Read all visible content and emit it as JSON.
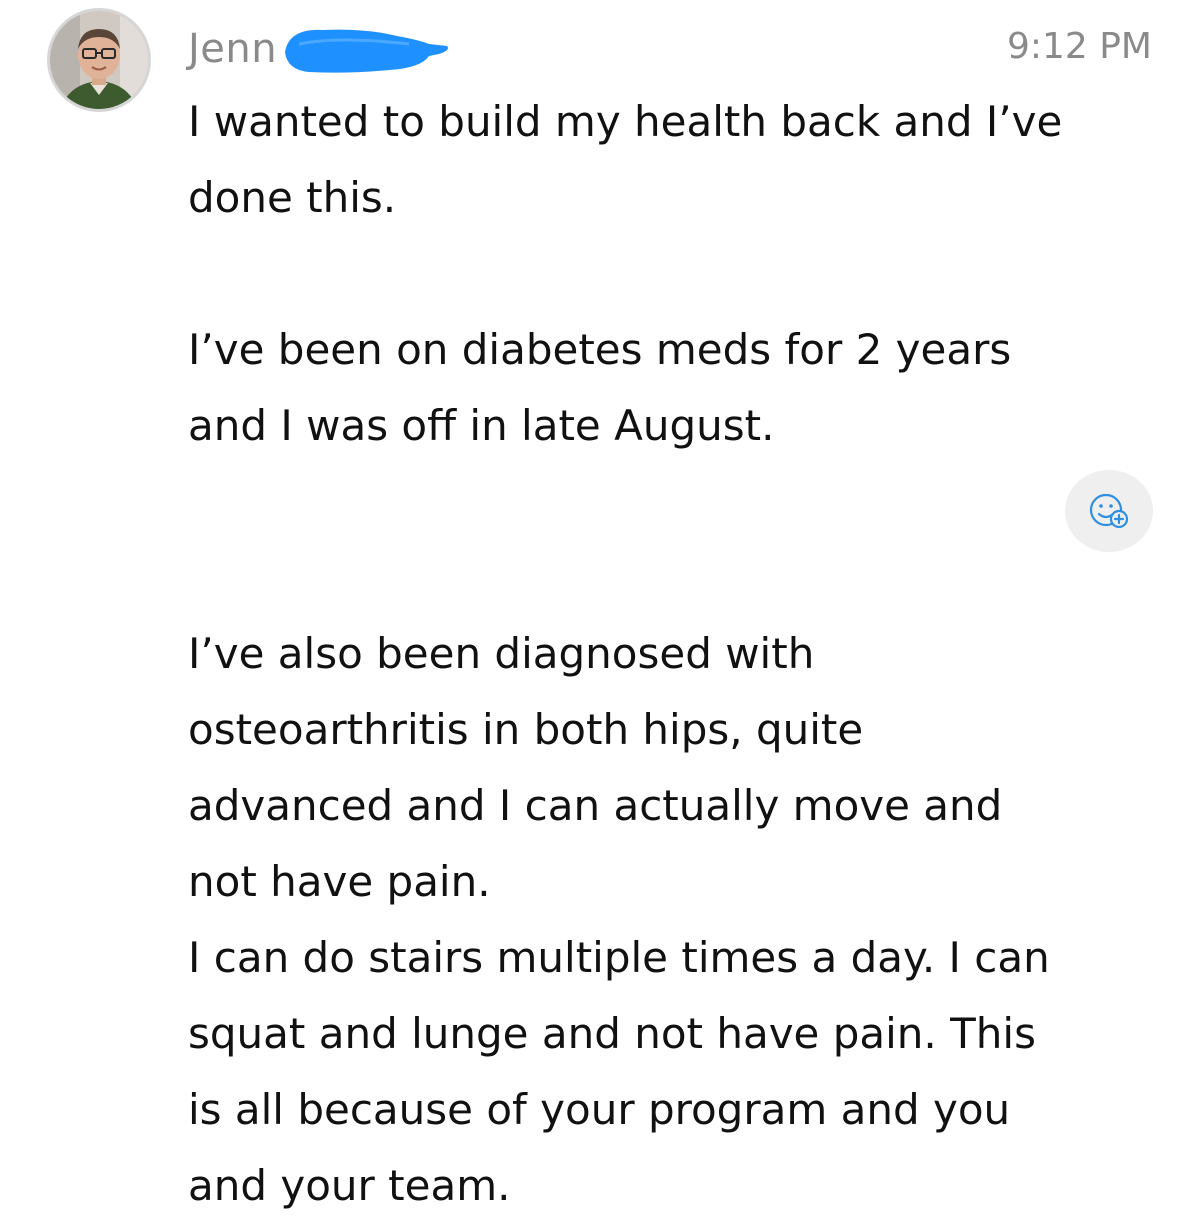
{
  "message": {
    "sender_name": "Jenn",
    "timestamp": "9:12 PM",
    "paragraphs": [
      [
        "I wanted to build my health back and I’ve",
        "done this."
      ],
      [
        "I’ve been on diabetes meds for 2 years",
        "and I was off in late August."
      ],
      [
        "I’ve also been diagnosed with",
        "osteoarthritis in both hips, quite",
        "advanced and I can actually move and",
        "not have pain.",
        "I can do stairs multiple times a day. I can",
        "squat and lunge and not have pain. This",
        "is all because of your program and you",
        "and your team."
      ]
    ]
  },
  "icons": {
    "avatar": "user-avatar-photo",
    "redaction": "redaction-scribble",
    "react": "add-reaction-icon"
  },
  "colors": {
    "redaction": "#1e90ff",
    "meta_text": "#8a8a8a",
    "body_text": "#111111",
    "react_bg": "#efefef"
  }
}
